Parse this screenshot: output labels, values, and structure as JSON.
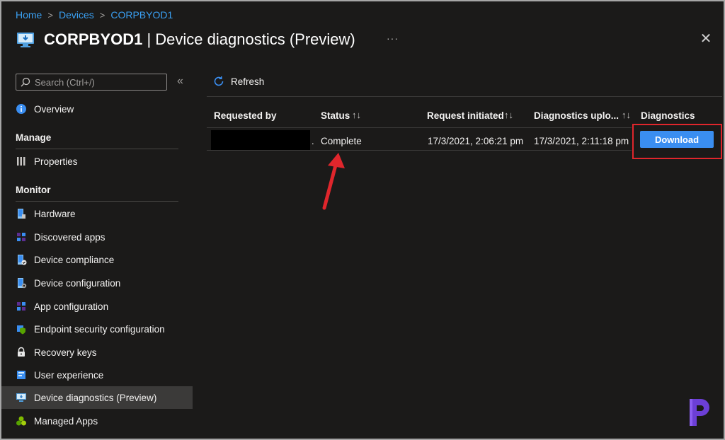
{
  "breadcrumb": {
    "home": "Home",
    "devices": "Devices",
    "device": "CORPBYOD1",
    "sep": ">"
  },
  "header": {
    "device_name": "CORPBYOD1",
    "title_rest": " | Device diagnostics (Preview)",
    "more": "···",
    "close": "✕"
  },
  "sidebar": {
    "search_placeholder": "Search (Ctrl+/)",
    "collapse": "«",
    "overview": "Overview",
    "manage_label": "Manage",
    "properties": "Properties",
    "monitor_label": "Monitor",
    "items": [
      {
        "label": "Hardware",
        "icon": "hardware-icon"
      },
      {
        "label": "Discovered apps",
        "icon": "discovered-apps-icon"
      },
      {
        "label": "Device compliance",
        "icon": "device-compliance-icon"
      },
      {
        "label": "Device configuration",
        "icon": "device-configuration-icon"
      },
      {
        "label": "App configuration",
        "icon": "app-configuration-icon"
      },
      {
        "label": "Endpoint security configuration",
        "icon": "endpoint-security-icon"
      },
      {
        "label": "Recovery keys",
        "icon": "recovery-keys-icon"
      },
      {
        "label": "User experience",
        "icon": "user-experience-icon"
      },
      {
        "label": "Device diagnostics (Preview)",
        "icon": "device-diagnostics-icon",
        "active": true
      },
      {
        "label": "Managed Apps",
        "icon": "managed-apps-icon"
      }
    ]
  },
  "toolbar": {
    "refresh": "Refresh"
  },
  "table": {
    "headers": {
      "requested_by": "Requested by",
      "status": "Status",
      "request_initiated": "Request initiated",
      "diagnostics_uploaded": "Diagnostics uplo...",
      "diagnostics": "Diagnostics"
    },
    "sort_glyph": "↑↓",
    "rows": [
      {
        "requested_by": ".",
        "status": "Complete",
        "request_initiated": "17/3/2021, 2:06:21 pm",
        "diagnostics_uploaded": "17/3/2021, 2:11:18 pm",
        "action": "Download"
      }
    ]
  },
  "colors": {
    "accent": "#3a8ef1",
    "link": "#3aa0f3",
    "highlight": "#e0262c",
    "background": "#1b1a19"
  }
}
